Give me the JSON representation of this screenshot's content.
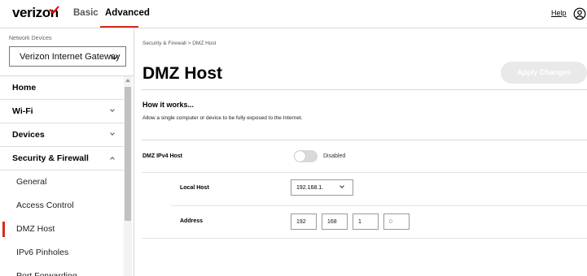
{
  "header": {
    "logo": "verizon",
    "tabs": {
      "basic": "Basic",
      "advanced": "Advanced"
    },
    "help": "Help",
    "colors": {
      "accent": "#d52b1e",
      "logo_check": "#ee0000"
    }
  },
  "sidebar": {
    "network_devices_label": "Network Devices",
    "selected_device": "Verizon Internet Gateway",
    "nav": [
      {
        "label": "Home"
      },
      {
        "label": "Wi-Fi"
      },
      {
        "label": "Devices"
      },
      {
        "label": "Security & Firewall"
      }
    ],
    "sub_items": [
      {
        "label": "General"
      },
      {
        "label": "Access Control"
      },
      {
        "label": "DMZ Host",
        "active": true
      },
      {
        "label": "IPv6 Pinholes"
      },
      {
        "label": "Port Forwarding"
      }
    ]
  },
  "main": {
    "breadcrumb": "Security & Firewall  >  DMZ Host",
    "title": "DMZ Host",
    "apply_button": "Apply Changes",
    "how_title": "How it works...",
    "how_desc": "Allow a single computer or device to be fully exposed to the Internet.",
    "dmz_label": "DMZ IPv4 Host",
    "toggle_state": "Disabled",
    "local_host_label": "Local Host",
    "local_host_value": "192.168.1.",
    "address_label": "Address",
    "address": [
      "192",
      "168",
      "1",
      "0"
    ]
  }
}
